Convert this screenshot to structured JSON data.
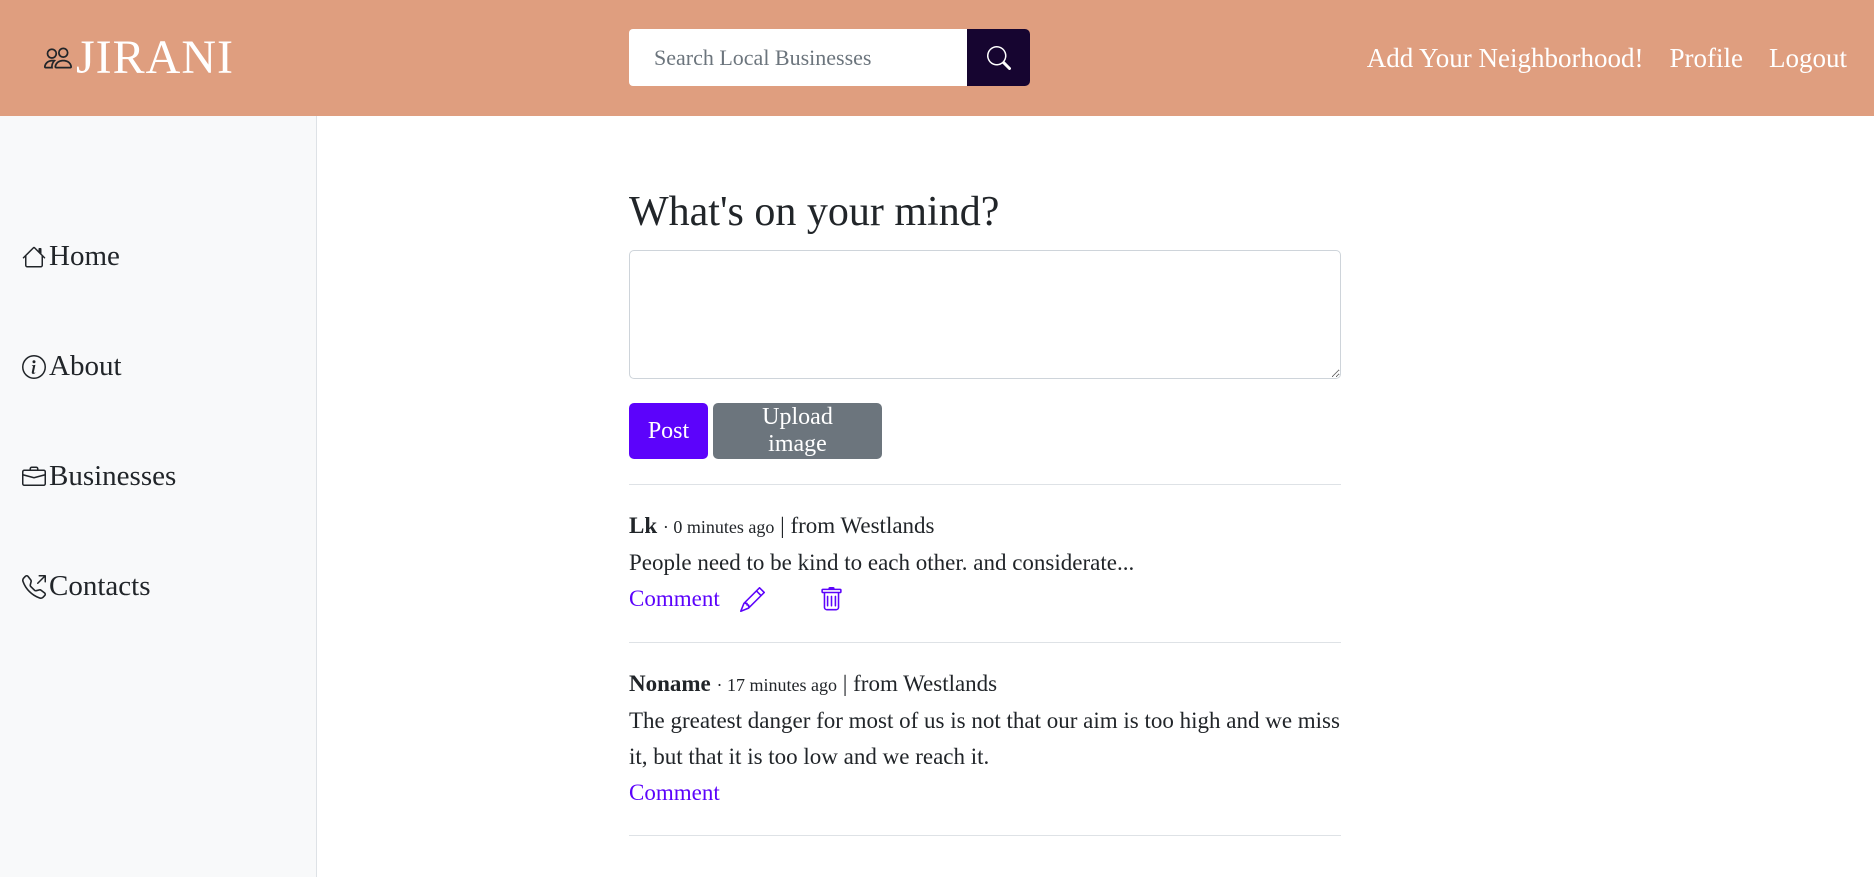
{
  "colors": {
    "navbar": "#df9e7f",
    "search_button": "#160530",
    "primary": "#5c03fb",
    "secondary": "#6c757d",
    "sidebar": "#f8f9fa"
  },
  "brand": {
    "icon": "people-icon",
    "name": "JIRANI"
  },
  "search": {
    "placeholder": "Search Local Businesses",
    "value": "",
    "icon": "search-icon"
  },
  "nav": {
    "add_neighborhood": "Add Your Neighborhood!",
    "profile": "Profile",
    "logout": "Logout"
  },
  "sidebar": {
    "items": [
      {
        "icon": "house-icon",
        "label": "Home"
      },
      {
        "icon": "info-circle-icon",
        "label": "About"
      },
      {
        "icon": "briefcase-icon",
        "label": "Businesses"
      },
      {
        "icon": "telephone-outbound-icon",
        "label": "Contacts"
      }
    ]
  },
  "composer": {
    "prompt": "What's on your mind?",
    "value": "",
    "post_label": "Post",
    "upload_label": "Upload image"
  },
  "posts": [
    {
      "author": "Lk",
      "time": "· 0 minutes ago",
      "location": " | from Westlands",
      "text": "People need to be kind to each other. and considerate...",
      "comment_label": "Comment",
      "actions": [
        "pencil-icon",
        "trash-icon"
      ]
    },
    {
      "author": "Noname",
      "time": "· 17 minutes ago",
      "location": " | from Westlands",
      "text": "The greatest danger for most of us is not that our aim is too high and we miss it, but that it is too low and we reach it.",
      "comment_label": "Comment",
      "actions": []
    }
  ]
}
